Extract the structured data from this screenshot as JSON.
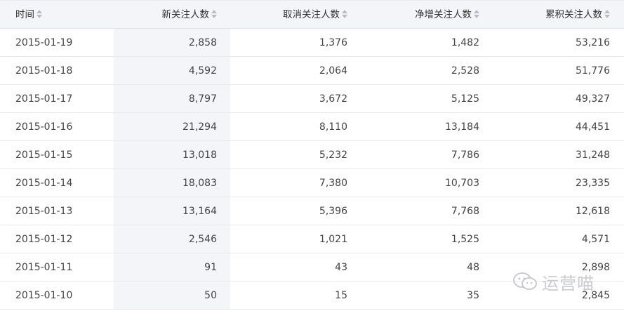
{
  "columns": [
    {
      "label": "时间"
    },
    {
      "label": "新关注人数"
    },
    {
      "label": "取消关注人数"
    },
    {
      "label": "净增关注人数"
    },
    {
      "label": "累积关注人数"
    }
  ],
  "rows": [
    [
      "2015-01-19",
      "2,858",
      "1,376",
      "1,482",
      "53,216"
    ],
    [
      "2015-01-18",
      "4,592",
      "2,064",
      "2,528",
      "51,776"
    ],
    [
      "2015-01-17",
      "8,797",
      "3,672",
      "5,125",
      "49,327"
    ],
    [
      "2015-01-16",
      "21,294",
      "8,110",
      "13,184",
      "44,451"
    ],
    [
      "2015-01-15",
      "13,018",
      "5,232",
      "7,786",
      "31,248"
    ],
    [
      "2015-01-14",
      "18,083",
      "7,380",
      "10,703",
      "23,335"
    ],
    [
      "2015-01-13",
      "13,164",
      "5,396",
      "7,768",
      "12,618"
    ],
    [
      "2015-01-12",
      "2,546",
      "1,021",
      "1,525",
      "4,571"
    ],
    [
      "2015-01-11",
      "91",
      "43",
      "48",
      "2,898"
    ],
    [
      "2015-01-10",
      "50",
      "15",
      "35",
      "2,845"
    ]
  ],
  "watermark": {
    "text": "运营喵",
    "icon": "wechat-icon"
  },
  "colors": {
    "header_bg": "#f4f5f9",
    "highlight_column_bg": "#f4f5f9",
    "border": "#e7e9ef",
    "sort_icon": "#b7bcc6"
  }
}
